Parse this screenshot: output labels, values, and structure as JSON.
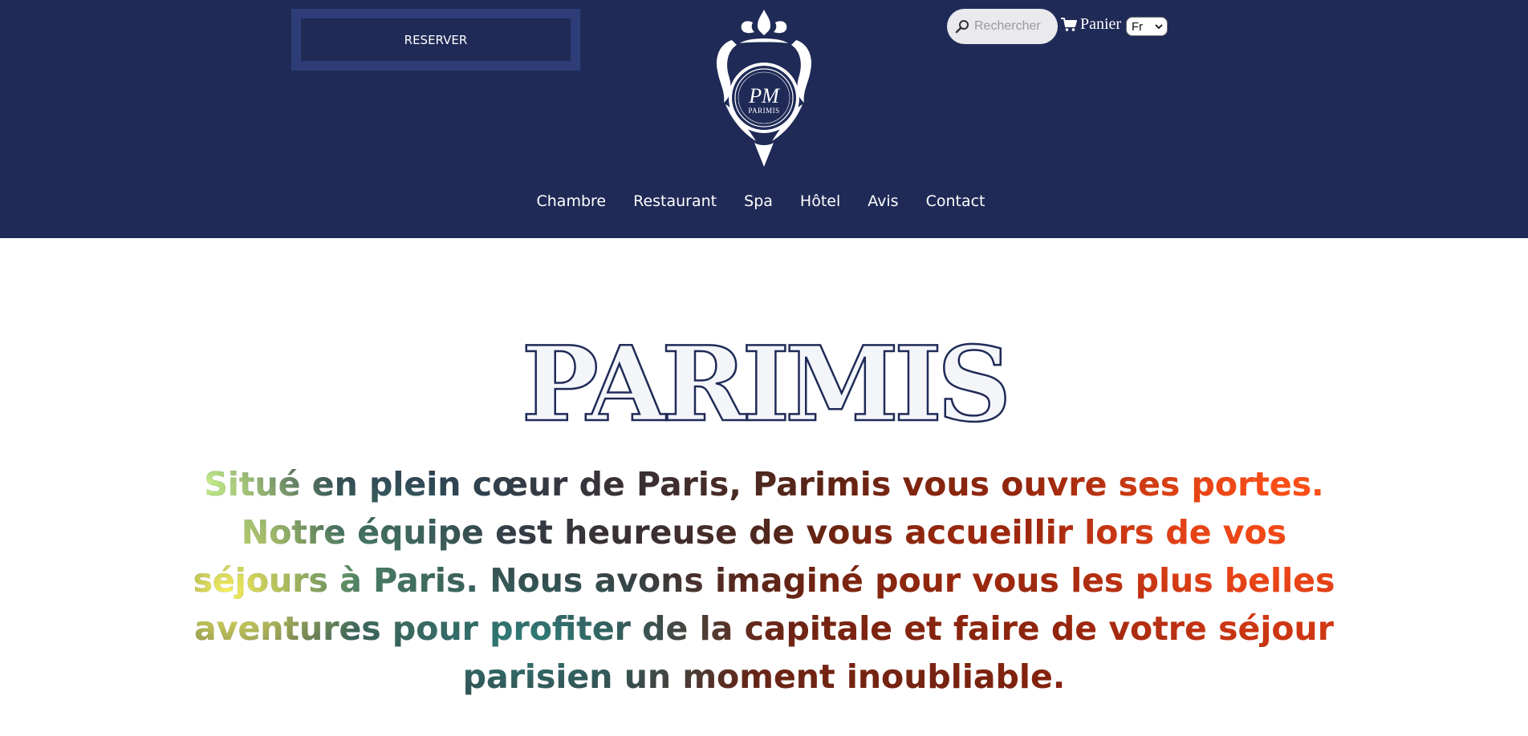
{
  "header": {
    "reserve_label": "RESERVER",
    "logo": {
      "monogram": "PM",
      "name": "PARIMIS"
    },
    "search": {
      "placeholder": "Rechercher",
      "icon": "search-icon"
    },
    "cart": {
      "label": "Panier",
      "icon": "cart-icon"
    },
    "language": {
      "selected": "Fr"
    }
  },
  "nav": {
    "items": [
      {
        "label": "Chambre"
      },
      {
        "label": "Restaurant"
      },
      {
        "label": "Spa"
      },
      {
        "label": "Hôtel"
      },
      {
        "label": "Avis"
      },
      {
        "label": "Contact"
      }
    ]
  },
  "main": {
    "title": "PARIMIS",
    "intro": "Situé en plein cœur de Paris, Parimis vous ouvre ses portes. Notre équipe est heureuse de vous accueillir lors de vos séjours à Paris. Nous avons imaginé pour vous les plus belles aventures pour profiter de la capitale et faire de votre séjour parisien un moment inoubliable."
  },
  "colors": {
    "header_bg": "#1f2a57",
    "reserve_frame": "#2e3d78",
    "title_stroke": "#1f2a57",
    "title_fill": "#f3f5f9",
    "page_bg": "#ffffff"
  }
}
